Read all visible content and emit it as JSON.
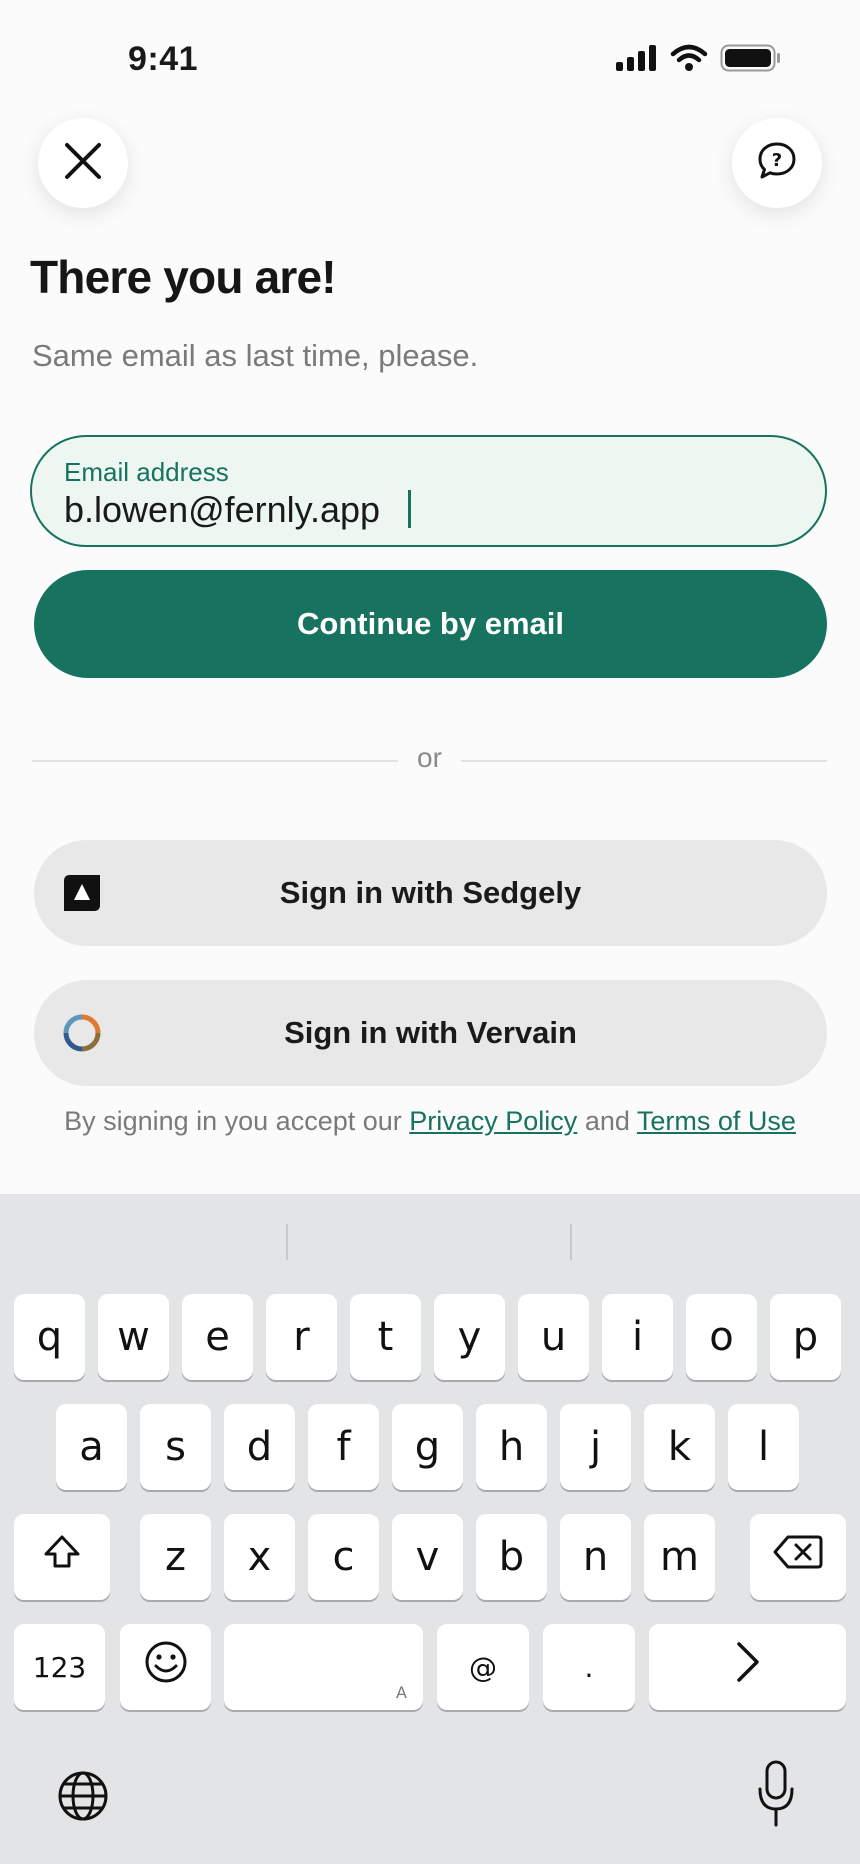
{
  "status_bar": {
    "time": "9:41",
    "icons": [
      "cellular-signal-icon",
      "wifi-icon",
      "battery-icon"
    ]
  },
  "header": {
    "close_icon": "close-icon",
    "help_icon": "help-bubble-icon"
  },
  "content": {
    "title": "There you are!",
    "subtitle": "Same email as last time, please."
  },
  "email_field": {
    "label": "Email address",
    "value": "b.lowen@fernly.app"
  },
  "primary_button": {
    "label": "Continue by email"
  },
  "divider": {
    "label": "or"
  },
  "social_buttons": [
    {
      "label": "Sign in with Sedgely",
      "icon": "sedgely-logo-icon"
    },
    {
      "label": "Sign in with Vervain",
      "icon": "vervain-logo-icon"
    }
  ],
  "legal": {
    "prefix": "By signing in you accept our ",
    "privacy_link": "Privacy Policy",
    "middle": " and ",
    "terms_link": "Terms of Use"
  },
  "keyboard": {
    "row1": [
      "q",
      "w",
      "e",
      "r",
      "t",
      "y",
      "u",
      "i",
      "o",
      "p"
    ],
    "row2": [
      "a",
      "s",
      "d",
      "f",
      "g",
      "h",
      "j",
      "k",
      "l"
    ],
    "row3": [
      "z",
      "x",
      "c",
      "v",
      "b",
      "n",
      "m"
    ],
    "numbers_key": "123",
    "at_key": "@",
    "dot_key": ".",
    "space_marker": "A"
  },
  "colors": {
    "accent": "#17735f",
    "field_background": "#eef6f2",
    "social_button": "#e7e8e7",
    "keyboard_background": "#e3e4e5"
  }
}
